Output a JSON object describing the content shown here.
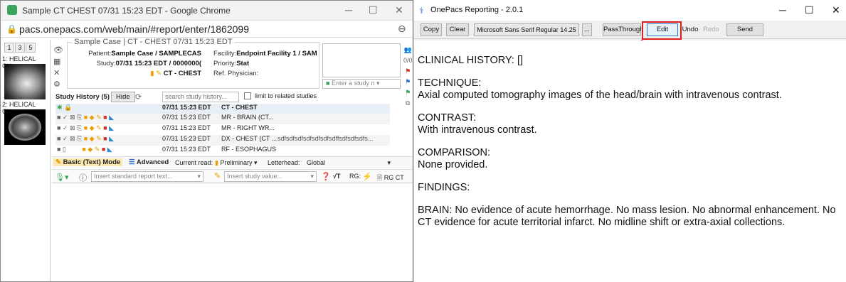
{
  "chrome": {
    "title": "Sample CT CHEST 07/31 15:23 EDT - Google Chrome",
    "url": "pacs.onepacs.com/web/main/#report/enter/1862099"
  },
  "thumbs": {
    "pages": [
      "1",
      "3",
      "5"
    ],
    "items": [
      "1: HELICAL CH...",
      "2: HELICAL CH..."
    ]
  },
  "case": {
    "title": "Sample Case | CT - CHEST 07/31 15:23 EDT",
    "patient_label": "Patient:",
    "patient": "Sample Case / SAMPLECAS",
    "facility_label": "Facility:",
    "facility": "Endpoint Facility 1 / SAM",
    "study_label": "Study:",
    "study": "07/31 15:23 EDT / 0000000(",
    "priority_label": "Priority:",
    "priority": "Stat",
    "modality": "CT - CHEST",
    "ref_label": "Ref. Physician:",
    "enter_study": "Enter a study n",
    "counter": "0/0"
  },
  "history": {
    "label": "Study History (5)",
    "hide": "Hide",
    "search_placeholder": "search study history...",
    "limit_label": "limit to related studies",
    "rows": [
      {
        "date": "07/31 15:23 EDT",
        "desc": "CT - CHEST",
        "extra": ""
      },
      {
        "date": "07/31 15:23 EDT",
        "desc": "MR - BRAIN (CT...",
        "extra": ""
      },
      {
        "date": "07/31 15:23 EDT",
        "desc": "MR - RIGHT WR...",
        "extra": ""
      },
      {
        "date": "07/31 15:23 EDT",
        "desc": "DX - CHEST (CT ...",
        "extra": "sdfsdfsdfsdfsdfsdfsdffsdfsdfsdfs..."
      },
      {
        "date": "07/31 15:23 EDT",
        "desc": "RF - ESOPHAGUS",
        "extra": ""
      }
    ]
  },
  "mode": {
    "basic": "Basic (Text) Mode",
    "advanced": "Advanced",
    "current_read_label": "Current read:",
    "current_read": "Preliminary",
    "letterhead_label": "Letterhead:",
    "letterhead": "Global"
  },
  "inserts": {
    "standard": "Insert standard report text...",
    "study_value": "Insert study value...",
    "rg_label": "RG:",
    "rg_ct": "RG CT"
  },
  "onepacs": {
    "title": "OnePacs Reporting - 2.0.1",
    "toolbar": {
      "copy": "Copy",
      "clear": "Clear",
      "font": "Microsoft Sans Serif Regular 14.25",
      "dots": "...",
      "passthrough": "PassThrough",
      "edit": "Edit",
      "undo": "Undo",
      "redo": "Redo",
      "send": "Send"
    }
  },
  "report": {
    "p1": "CLINICAL HISTORY: []",
    "p2a": "TECHNIQUE:",
    "p2b": "Axial computed tomography images of the head/brain with intravenous contrast.",
    "p3a": "CONTRAST:",
    "p3b": "With intravenous contrast.",
    "p4a": "COMPARISON:",
    "p4b": "None provided.",
    "p5": "FINDINGS:",
    "p6": "BRAIN: No evidence of acute hemorrhage. No mass lesion. No abnormal enhancement. No CT evidence for acute territorial infarct. No midline shift or extra-axial collections."
  },
  "colors": {
    "highlight": "#e02020",
    "arrow": "#e02020",
    "accent": "#1a7fd4"
  }
}
